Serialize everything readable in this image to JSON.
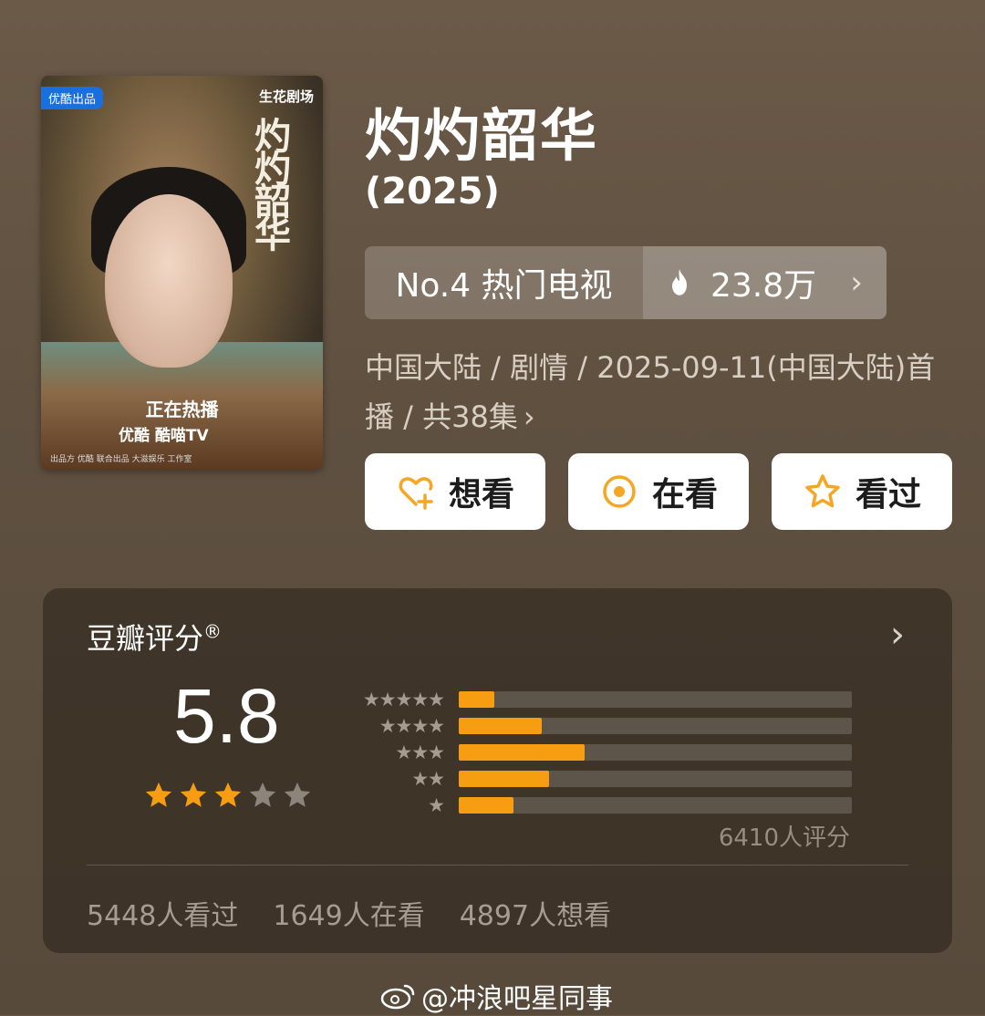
{
  "poster": {
    "badge": "优酷出品",
    "studio": "生花剧场",
    "title_vertical": "灼灼韶华",
    "airing": "正在热播",
    "platforms": "优酷  酷喵TV",
    "footer": "出品方 优酷   联合出品 大滋娱乐   工作室"
  },
  "title": "灼灼韶华",
  "year": "(2025)",
  "rank": {
    "label": "No.4 热门电视",
    "heat": "23.8万",
    "chevron": "›"
  },
  "meta": {
    "line": "中国大陆 / 剧情 / 2025-09-11(中国大陆)首播 / 共38集",
    "chevron": "›"
  },
  "actions": [
    {
      "label": "想看",
      "icon": "heart-plus-icon"
    },
    {
      "label": "在看",
      "icon": "target-icon"
    },
    {
      "label": "看过",
      "icon": "star-outline-icon"
    }
  ],
  "rating": {
    "title": "豆瓣评分",
    "reg": "®",
    "chevron": "›",
    "score": "5.8",
    "stars_filled": 3,
    "stars_total": 5,
    "distribution": [
      {
        "stars": "★★★★★",
        "fraction": 0.09
      },
      {
        "stars": "★★★★",
        "fraction": 0.21
      },
      {
        "stars": "★★★",
        "fraction": 0.32
      },
      {
        "stars": "★★",
        "fraction": 0.23
      },
      {
        "stars": "★",
        "fraction": 0.14
      }
    ],
    "count": "6410人评分",
    "watched": "5448人看过",
    "watching": "1649人在看",
    "wish": "4897人想看"
  },
  "watermark": {
    "text": "@冲浪吧星同事",
    "icon": "weibo-icon"
  },
  "colors": {
    "accent": "#f79d12",
    "button_icon": "#f5a623"
  }
}
